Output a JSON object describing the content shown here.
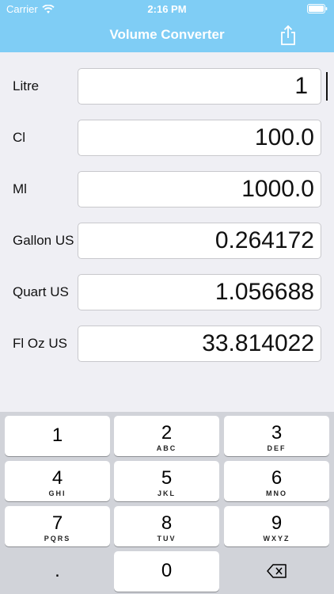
{
  "status": {
    "carrier": "Carrier",
    "time": "2:16 PM"
  },
  "nav": {
    "title": "Volume Converter"
  },
  "rows": [
    {
      "label": "Litre",
      "value": "1"
    },
    {
      "label": "Cl",
      "value": "100.0"
    },
    {
      "label": "Ml",
      "value": "1000.0"
    },
    {
      "label": "Gallon US",
      "value": "0.264172"
    },
    {
      "label": "Quart US",
      "value": "1.056688"
    },
    {
      "label": "Fl Oz US",
      "value": "33.814022"
    }
  ],
  "keyboard": {
    "keys": [
      {
        "num": "1",
        "letters": ""
      },
      {
        "num": "2",
        "letters": "ABC"
      },
      {
        "num": "3",
        "letters": "DEF"
      },
      {
        "num": "4",
        "letters": "GHI"
      },
      {
        "num": "5",
        "letters": "JKL"
      },
      {
        "num": "6",
        "letters": "MNO"
      },
      {
        "num": "7",
        "letters": "PQRS"
      },
      {
        "num": "8",
        "letters": "TUV"
      },
      {
        "num": "9",
        "letters": "WXYZ"
      },
      {
        "num": ".",
        "letters": ""
      },
      {
        "num": "0",
        "letters": ""
      }
    ]
  },
  "icons": {
    "wifi": "wifi-icon",
    "battery": "battery-icon",
    "share": "share-icon",
    "delete": "delete-backspace-icon"
  },
  "colors": {
    "accent": "#7fcdf5",
    "background": "#efeff4",
    "keyboard": "#d1d3d9"
  }
}
